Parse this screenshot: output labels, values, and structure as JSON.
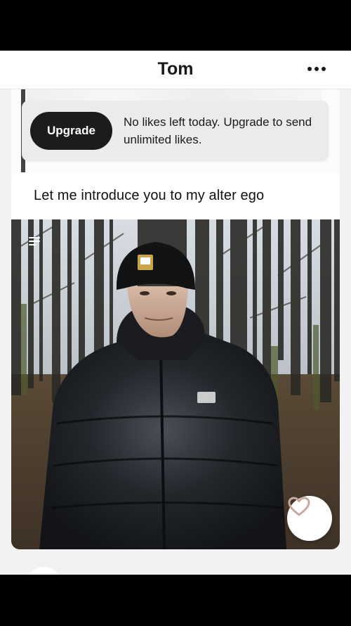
{
  "header": {
    "title": "Tom",
    "more_icon": "more-horizontal-icon"
  },
  "toast": {
    "button_label": "Upgrade",
    "message": "No likes left today. Upgrade to send unlimited likes."
  },
  "card": {
    "prompt": "Let me introduce you to my alter ego",
    "photo_description_icon": "caption-lines-icon",
    "like_icon": "heart-icon"
  },
  "colors": {
    "accent": "#1c1c1c",
    "background": "#f2f2f2",
    "heart_stroke": "#c9a99d"
  }
}
